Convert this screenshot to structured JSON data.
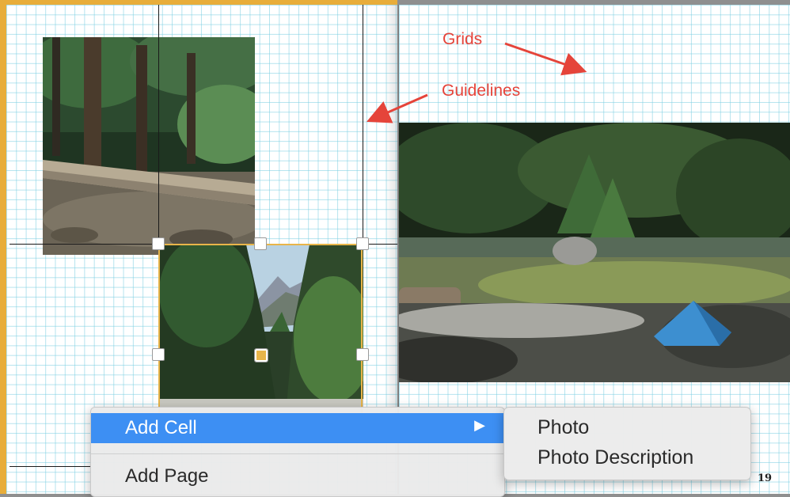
{
  "annotations": {
    "grids_label": "Grids",
    "guidelines_label": "Guidelines",
    "color": "#e5443a"
  },
  "page": {
    "number": "19",
    "grid_color": "#78cde1",
    "selection_color": "#e8b54a"
  },
  "photos": [
    {
      "name": "forest-log",
      "subject": "forest with fallen log"
    },
    {
      "name": "mountain-valley",
      "subject": "forest valley with mountain"
    },
    {
      "name": "campsite",
      "subject": "blue tent by a river in forest"
    }
  ],
  "context_menu": {
    "items": [
      {
        "label": "Add Cell",
        "highlighted": true,
        "has_submenu": true
      },
      {
        "label": "Add Page",
        "highlighted": false,
        "has_submenu": false
      }
    ],
    "submenu_indicator": "▶",
    "highlight_color": "#3d8ff3"
  },
  "submenu": {
    "items": [
      {
        "label": "Photo"
      },
      {
        "label": "Photo Description"
      }
    ]
  }
}
